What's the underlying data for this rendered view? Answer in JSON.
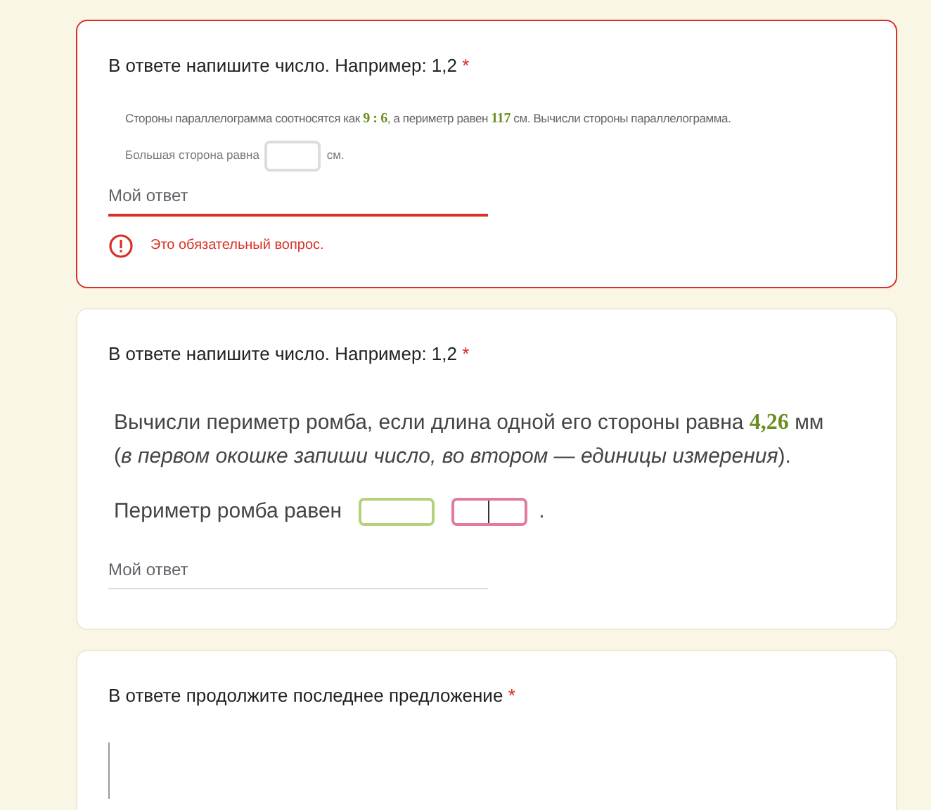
{
  "questions": [
    {
      "kind": "compact",
      "title": "В ответе напишите число. Например: 1,2",
      "required_mark": "*",
      "error": true,
      "problem": [
        {
          "kind": "text",
          "text": "Стороны параллелограмма соотносятся как "
        },
        {
          "kind": "math",
          "text": "9 : 6"
        },
        {
          "kind": "text",
          "text": ", а периметр равен "
        },
        {
          "kind": "math",
          "text": "117"
        },
        {
          "kind": "text",
          "text": " см. Вычисли стороны параллелограмма."
        }
      ],
      "answer_line": {
        "label": "Большая сторона равна",
        "boxes": [
          {
            "color": "#dddddd",
            "split": false
          }
        ],
        "suffix": "см."
      },
      "answer_placeholder": "Мой ответ",
      "error_text": "Это обязательный вопрос."
    },
    {
      "kind": "fill",
      "title": "В ответе напишите число. Например: 1,2",
      "required_mark": "*",
      "error": false,
      "problem": [
        {
          "kind": "text",
          "text": "Вычисли периметр ромба, если длина одной его стороны равна "
        },
        {
          "kind": "math",
          "text": "4,26"
        },
        {
          "kind": "text",
          "text": " мм"
        },
        {
          "kind": "break"
        },
        {
          "kind": "text",
          "text": "(*в первом окошке запиши число, во втором — единицы измерения*)."
        }
      ],
      "answer_line": {
        "label": "Периметр ромба равен",
        "boxes": [
          {
            "color": "#b5d17a",
            "split": false
          },
          {
            "color": "#e27a9c",
            "split": true
          }
        ],
        "suffix": "."
      },
      "answer_placeholder": "Мой ответ"
    },
    {
      "kind": "figure",
      "title": "В ответе продолжите последнее предложение",
      "required_mark": "*",
      "error": false
    }
  ]
}
